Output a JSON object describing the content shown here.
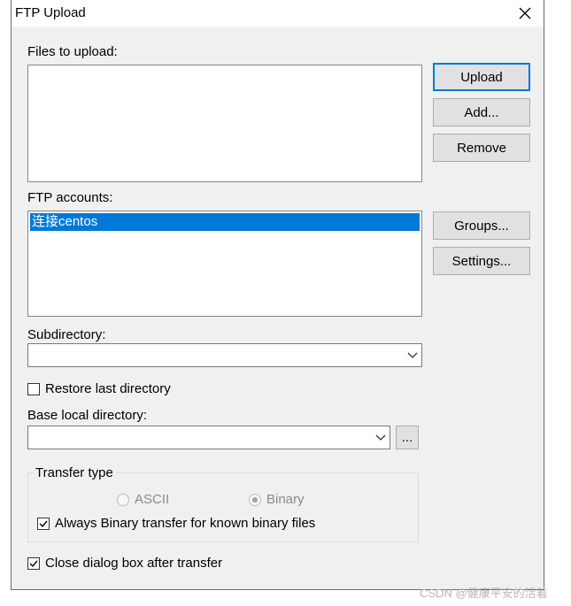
{
  "window": {
    "title": "FTP Upload"
  },
  "files": {
    "label": "Files to upload:",
    "items": []
  },
  "buttons": {
    "upload": "Upload",
    "add": "Add...",
    "remove": "Remove",
    "groups": "Groups...",
    "settings": "Settings...",
    "browse": "..."
  },
  "accounts": {
    "label": "FTP accounts:",
    "items": [
      "连接centos"
    ],
    "selected": "连接centos"
  },
  "subdirectory": {
    "label": "Subdirectory:",
    "value": ""
  },
  "restore": {
    "label": "Restore last directory",
    "checked": false
  },
  "base_local": {
    "label": "Base local directory:",
    "value": ""
  },
  "transfer": {
    "label": "Transfer type",
    "ascii": "ASCII",
    "binary": "Binary",
    "selected": "Binary",
    "always_binary": {
      "label": "Always Binary transfer for known binary files",
      "checked": true
    }
  },
  "close_after": {
    "label": "Close dialog box after transfer",
    "checked": true
  },
  "watermark": "CSDN @健康平安的活着",
  "colors": {
    "selection": "#0078d7",
    "default_button_border": "#0078d7",
    "dialog_bg": "#f0f0f0"
  }
}
